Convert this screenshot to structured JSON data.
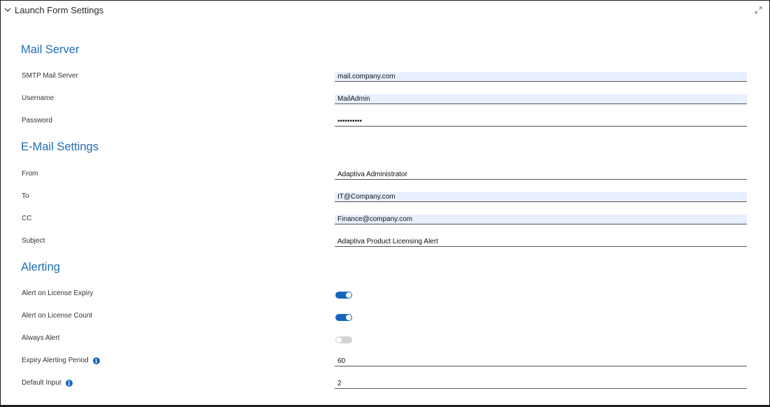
{
  "panel": {
    "title": "Launch Form Settings"
  },
  "mail_server": {
    "title": "Mail Server",
    "smtp": {
      "label": "SMTP Mail Server",
      "value": "mail.company.com"
    },
    "username": {
      "label": "Username",
      "value": "MailAdmin"
    },
    "password": {
      "label": "Password",
      "value": "••••••••••"
    }
  },
  "email_settings": {
    "title": "E-Mail Settings",
    "from": {
      "label": "From",
      "value": "Adaptiva Administrator"
    },
    "to": {
      "label": "To",
      "value": "IT@Company.com"
    },
    "cc": {
      "label": "CC",
      "value": "Finance@company.com"
    },
    "subject": {
      "label": "Subject",
      "value": "Adaptiva Product Licensing Alert"
    }
  },
  "alerting": {
    "title": "Alerting",
    "expiry": {
      "label": "Alert on License Expiry",
      "on": true
    },
    "count": {
      "label": "Alert on License Count",
      "on": true
    },
    "always": {
      "label": "Always Alert",
      "on": false
    },
    "period": {
      "label": "Expiry Alerting Period",
      "value": "60"
    },
    "default_input": {
      "label": "Default Input",
      "value": "2"
    }
  },
  "colors": {
    "accent": "#1565c0",
    "heading": "#1f6db5",
    "autofill": "#e8f0fe"
  },
  "icons": {
    "collapse": "chevron-down-icon",
    "expand": "expand-icon",
    "info": "info-icon"
  }
}
